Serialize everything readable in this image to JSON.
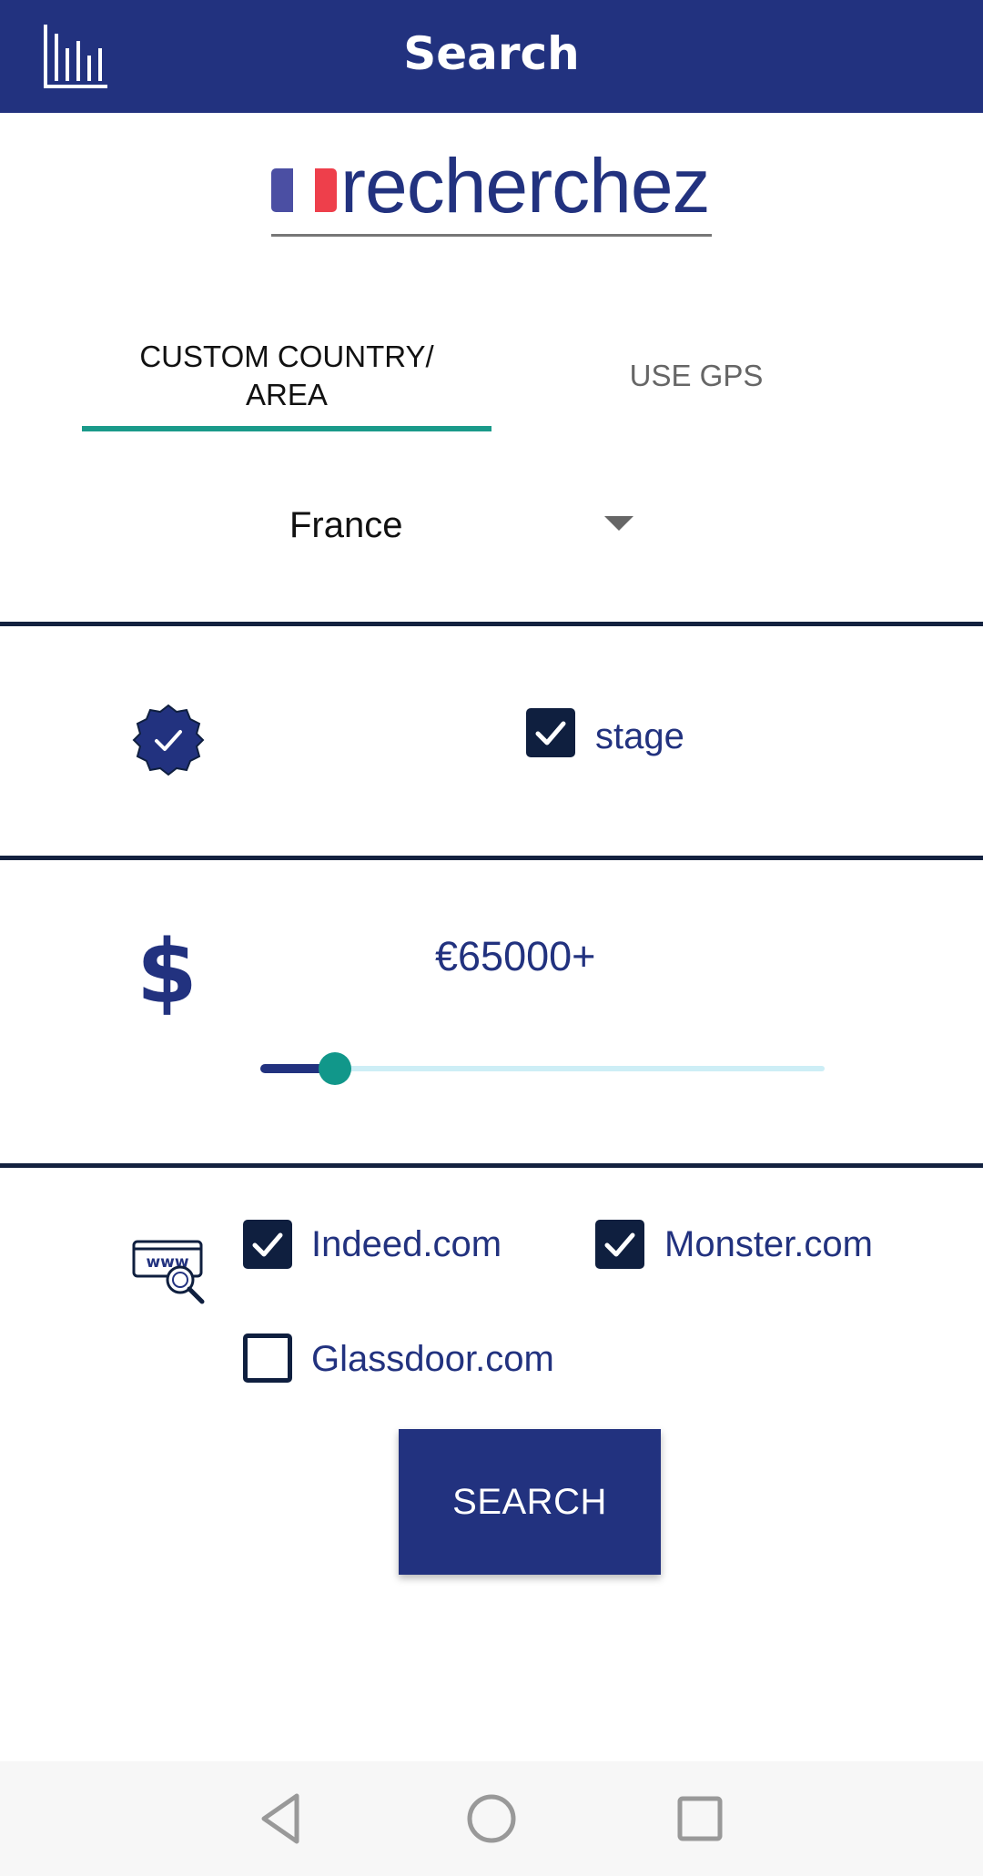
{
  "appbar": {
    "title": "Search",
    "stats_icon": "bar-chart-icon"
  },
  "keyword": {
    "value": "recherchez",
    "flag": "france-flag",
    "flag_colors": [
      "#4b4fa3",
      "#ffffff",
      "#ee3f4b"
    ]
  },
  "tabs": [
    {
      "label": "CUSTOM COUNTRY/\nAREA",
      "selected": true
    },
    {
      "label": "USE GPS",
      "selected": false
    }
  ],
  "country": {
    "selected": "France",
    "icon": "dropdown-arrow-icon"
  },
  "job_type": {
    "icon": "verified-badge-icon",
    "option": {
      "label": "stage",
      "checked": true
    }
  },
  "salary": {
    "icon": "dollar-icon",
    "display": "€65000+",
    "slider_fraction": 0.133
  },
  "job_sites": {
    "icon": "www-search-icon",
    "options": [
      {
        "label": "Indeed.com",
        "checked": true
      },
      {
        "label": "Monster.com",
        "checked": true
      },
      {
        "label": "Glassdoor.com",
        "checked": false
      }
    ]
  },
  "search_button": {
    "label": "SEARCH"
  },
  "navbar": {
    "back": "back-triangle-icon",
    "home": "home-circle-icon",
    "recents": "recents-square-icon"
  },
  "colors": {
    "primary": "#22327f",
    "accent": "#11978a",
    "dark": "#0f1f3f"
  }
}
